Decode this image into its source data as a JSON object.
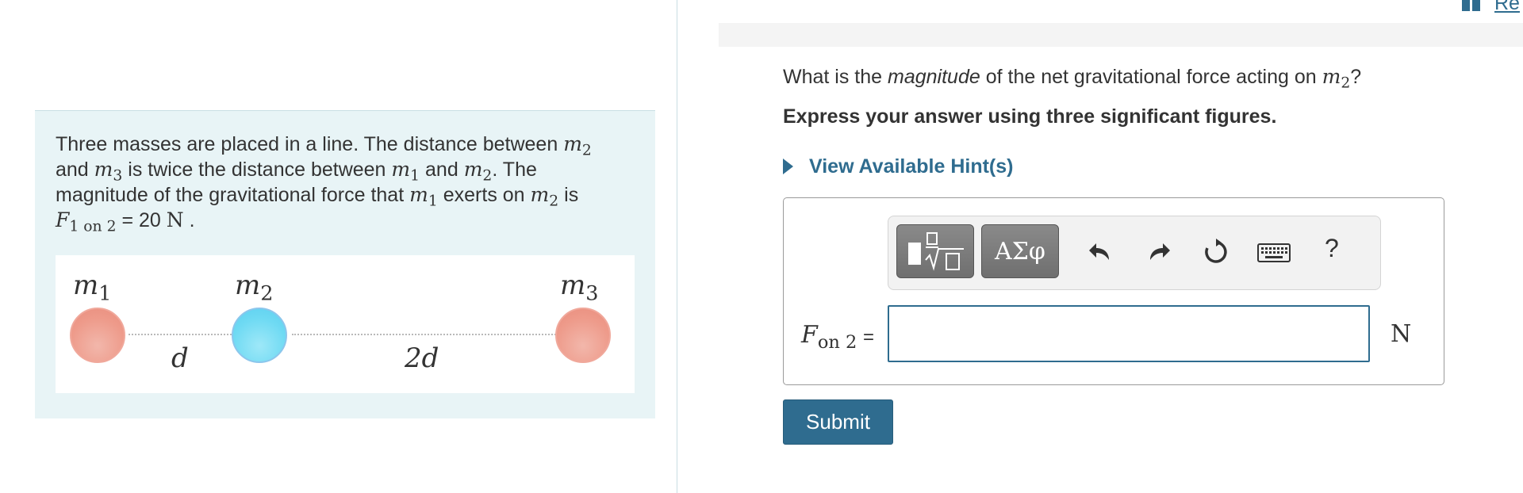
{
  "corner": {
    "link_text": "Re"
  },
  "problem": {
    "sentence1": "Three masses are placed in a line.  The distance between",
    "m2": "m",
    "sub_2": "2",
    "sub_1": "1",
    "sub_3": "3",
    "and": "and",
    "is_twice": "is twice the distance between",
    "and2": "and",
    "the_period": ".  The",
    "sentence3": "magnitude of the gravitational force that",
    "exerts_on": "exerts on",
    "is": "is",
    "F": "F",
    "F_sub": "1 on 2",
    "equals": "= 20",
    "unit": "N",
    "period": "."
  },
  "diagram": {
    "m_symbol": "m",
    "labels": {
      "m1": "1",
      "m2": "2",
      "m3": "3"
    },
    "dist_d": "d",
    "dist_2d": "2d",
    "colors": {
      "m1": "#ee9b8b",
      "m2": "#6fdaf3",
      "m3": "#ee9b8b"
    }
  },
  "question": {
    "prefix": "What is the",
    "emphasis": "magnitude",
    "suffix": "of the net gravitational force acting on",
    "var": "m",
    "var_sub": "2",
    "end": "?"
  },
  "instructions": "Express your answer using three significant figures.",
  "hint": {
    "label": "View Available Hint(s)"
  },
  "toolbar": {
    "buttons": [
      {
        "name": "templates-button",
        "icon": "fraction-sqrt-icon"
      },
      {
        "name": "symbols-button",
        "label": "ΑΣφ"
      }
    ],
    "icons": [
      "undo-icon",
      "redo-icon",
      "reset-icon",
      "keyboard-icon"
    ],
    "help": "?"
  },
  "answer": {
    "var": "F",
    "var_sub": "on 2",
    "equals": "=",
    "value": "",
    "unit": "N"
  },
  "submit": {
    "label": "Submit"
  },
  "colors": {
    "accent": "#2f6c8f",
    "panel_bg": "#e8f4f6"
  }
}
